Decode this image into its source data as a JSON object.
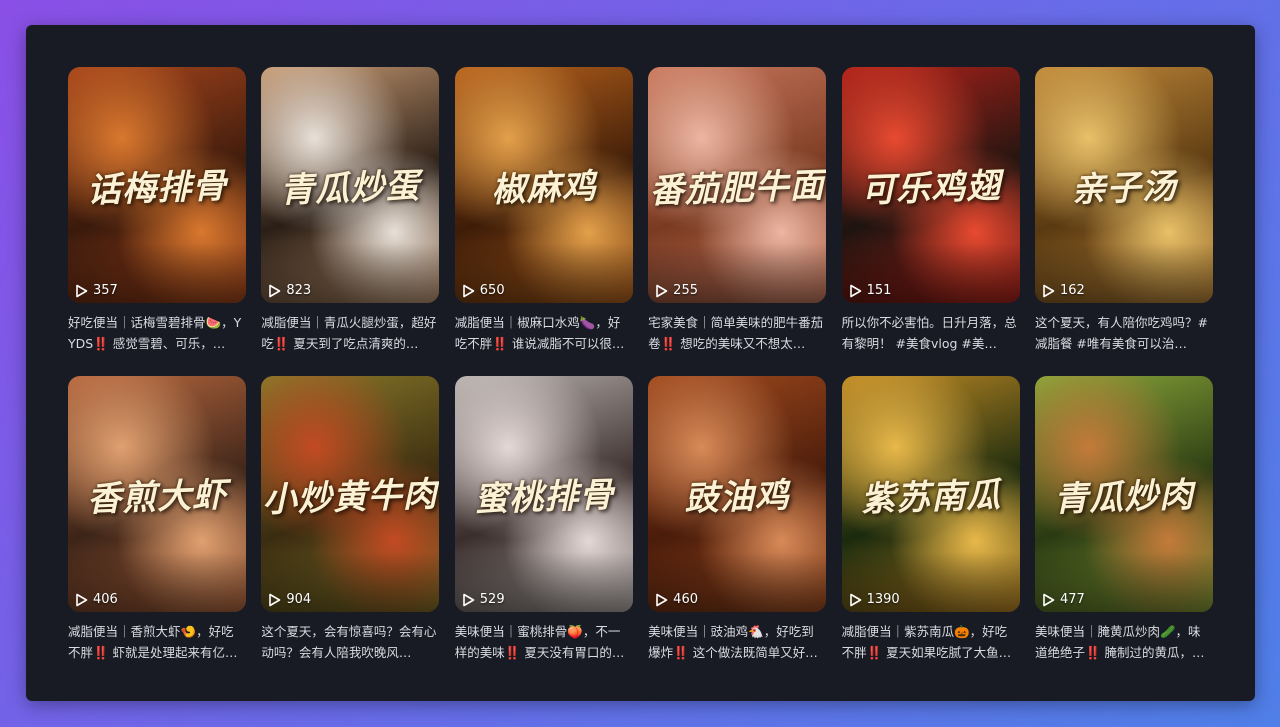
{
  "cards": [
    {
      "title": "话梅排骨",
      "views": "357",
      "desc": "好吃便当｜话梅雪碧排骨🍉，YYDS‼️ 感觉雪碧、可乐，…",
      "colors": [
        "#3a1a0c",
        "#a8451c",
        "#d9782e"
      ]
    },
    {
      "title": "青瓜炒蛋",
      "views": "823",
      "desc": "减脂便当｜青瓜火腿炒蛋，超好吃‼️ 夏天到了吃点清爽的…",
      "colors": [
        "#2a1e16",
        "#c79a72",
        "#e8e0d8"
      ]
    },
    {
      "title": "椒麻鸡",
      "views": "650",
      "desc": "减脂便当｜椒麻口水鸡🍆，好吃不胖‼️ 谁说减脂不可以很…",
      "colors": [
        "#3d1c08",
        "#b8621c",
        "#e3a04a"
      ]
    },
    {
      "title": "番茄肥牛面",
      "views": "255",
      "desc": "宅家美食｜简单美味的肥牛番茄卷‼️ 想吃的美味又不想太…",
      "colors": [
        "#7a3a22",
        "#c9785c",
        "#ecb6a2"
      ]
    },
    {
      "title": "可乐鸡翅",
      "views": "151",
      "desc": "所以你不必害怕。日升月落，总有黎明！ #美食vlog #美…",
      "colors": [
        "#1e1410",
        "#b0221a",
        "#e84a30"
      ]
    },
    {
      "title": "亲子汤",
      "views": "162",
      "desc": "这个夏天，有人陪你吃鸡吗？#减脂餐 #唯有美食可以治…",
      "colors": [
        "#5a3a12",
        "#c08838",
        "#e8c068"
      ]
    },
    {
      "title": "香煎大虾",
      "views": "406",
      "desc": "减脂便当｜香煎大虾🍤，好吃不胖‼️ 虾就是处理起来有亿…",
      "colors": [
        "#3c2418",
        "#b8683e",
        "#e0a070"
      ]
    },
    {
      "title": "小炒黄牛肉",
      "views": "904",
      "desc": "这个夏天，会有惊喜吗？会有心动吗？会有人陪我吹晚风…",
      "colors": [
        "#3a2c10",
        "#8a7a2a",
        "#c24a22"
      ]
    },
    {
      "title": "蜜桃排骨",
      "views": "529",
      "desc": "美味便当｜蜜桃排骨🍑，不一样的美味‼️ 夏天没有胃口的…",
      "colors": [
        "#3a2e2c",
        "#b9b2ae",
        "#e4d8d6"
      ]
    },
    {
      "title": "豉油鸡",
      "views": "460",
      "desc": "美味便当｜豉油鸡🐔，好吃到爆炸‼️ 这个做法既简单又好…",
      "colors": [
        "#4a1c0a",
        "#a04a1e",
        "#d88a58"
      ]
    },
    {
      "title": "紫苏南瓜",
      "views": "1390",
      "desc": "减脂便当｜紫苏南瓜🎃，好吃不胖‼️ 夏天如果吃腻了大鱼…",
      "colors": [
        "#1a2a0e",
        "#c08a24",
        "#e8b84a"
      ]
    },
    {
      "title": "青瓜炒肉",
      "views": "477",
      "desc": "美味便当｜腌黄瓜炒肉🥒，味道绝绝子‼️ 腌制过的黄瓜，…",
      "colors": [
        "#2a3a12",
        "#8aa83a",
        "#c47a3a"
      ]
    }
  ]
}
